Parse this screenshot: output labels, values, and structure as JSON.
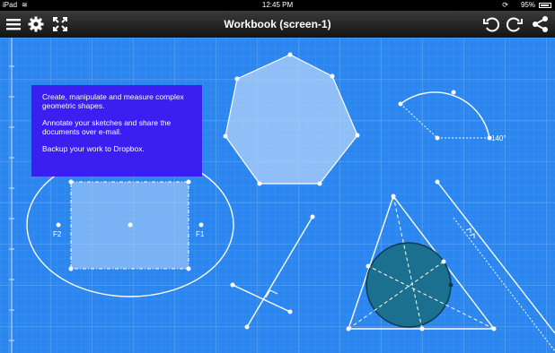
{
  "status_bar": {
    "carrier": "iPad",
    "time": "12:45 PM",
    "battery": "95%"
  },
  "toolbar": {
    "title": "Workbook (screen-1)",
    "left_icons": [
      "menu-icon",
      "gear-icon",
      "fullscreen-icon"
    ],
    "right_icons": [
      "undo-icon",
      "redo-icon",
      "share-icon"
    ]
  },
  "info_box": {
    "line1": "Create, manipulate and measure complex geometric shapes.",
    "line2": "Annotate your sketches and share the documents over e-mail.",
    "line3": "Backup your work to Dropbox."
  },
  "canvas_labels": {
    "focus_left": "F2",
    "focus_right": "F1",
    "angle": "140°"
  },
  "colors": {
    "canvas": "#2b86f0",
    "info_box": "#3b1ef0",
    "circle_fill": "#1b6f8f"
  }
}
